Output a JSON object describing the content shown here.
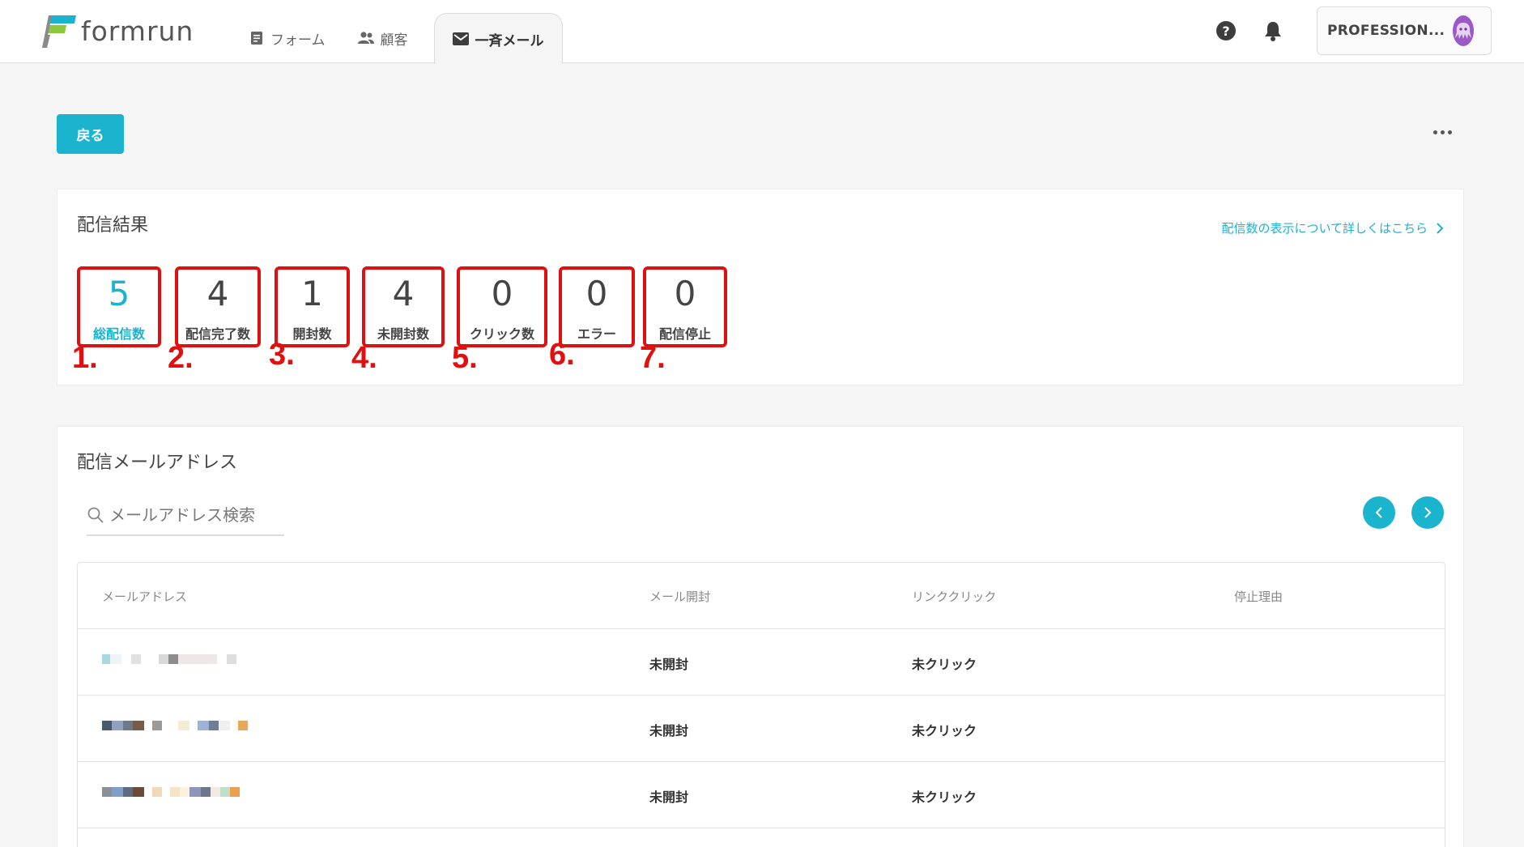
{
  "header": {
    "logo_text": "formrun",
    "nav": [
      {
        "label": "フォーム",
        "icon": "form-icon"
      },
      {
        "label": "顧客",
        "icon": "users-icon"
      },
      {
        "label": "一斉メール",
        "icon": "mail-icon",
        "active": true
      }
    ],
    "help_glyph": "?",
    "account_name": "PROFESSION..."
  },
  "toolbar": {
    "back_label": "戻る"
  },
  "results": {
    "title": "配信結果",
    "help_link": "配信数の表示について詳しくはこちら",
    "stats": [
      {
        "value": "5",
        "label": "総配信数",
        "marker": "1."
      },
      {
        "value": "4",
        "label": "配信完了数",
        "marker": "2."
      },
      {
        "value": "1",
        "label": "開封数",
        "marker": "3."
      },
      {
        "value": "4",
        "label": "未開封数",
        "marker": "4."
      },
      {
        "value": "0",
        "label": "クリック数",
        "marker": "5."
      },
      {
        "value": "0",
        "label": "エラー",
        "marker": "6."
      },
      {
        "value": "0",
        "label": "配信停止",
        "marker": "7."
      }
    ]
  },
  "addresses": {
    "title": "配信メールアドレス",
    "search_placeholder": "メールアドレス検索",
    "columns": [
      "メールアドレス",
      "メール開封",
      "リンククリック",
      "停止理由"
    ],
    "rows": [
      {
        "open": "未開封",
        "click": "未クリック",
        "stop": ""
      },
      {
        "open": "未開封",
        "click": "未クリック",
        "stop": ""
      },
      {
        "open": "未開封",
        "click": "未クリック",
        "stop": ""
      }
    ]
  },
  "colors": {
    "accent": "#1ab4cf",
    "annotation": "#e01010",
    "avatar": "#9b59c7"
  }
}
